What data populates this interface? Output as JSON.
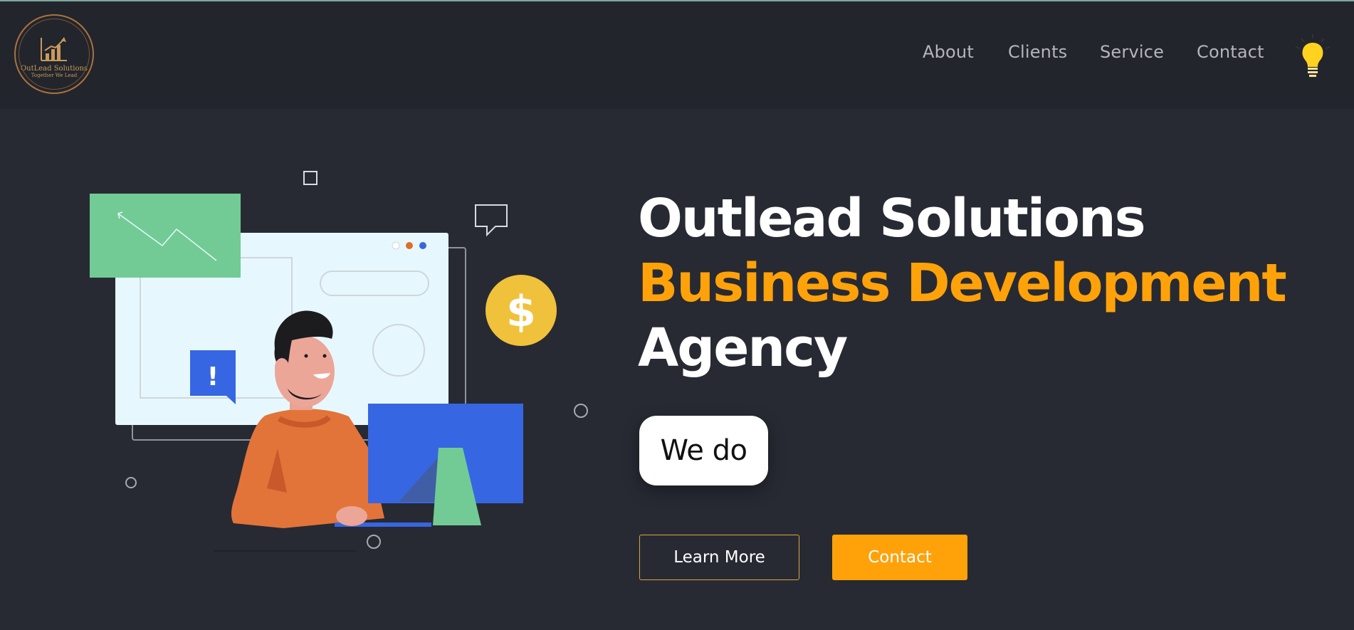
{
  "brand": {
    "name": "OutLead Solutions",
    "tagline": "Together We Lead",
    "accent": "#ffa20a",
    "logo_gold": "#c89a5c"
  },
  "nav": {
    "items": [
      {
        "label": "About"
      },
      {
        "label": "Clients"
      },
      {
        "label": "Service"
      },
      {
        "label": "Contact"
      }
    ],
    "theme_icon": "lightbulb-icon"
  },
  "hero": {
    "line1": "Outlead Solutions",
    "line2": "Business Development",
    "line3": "Agency",
    "typed_text": "We do",
    "learn_more_label": "Learn More",
    "contact_label": "Contact"
  },
  "illustration": {
    "alert_glyph": "!",
    "coin_glyph": "$"
  }
}
